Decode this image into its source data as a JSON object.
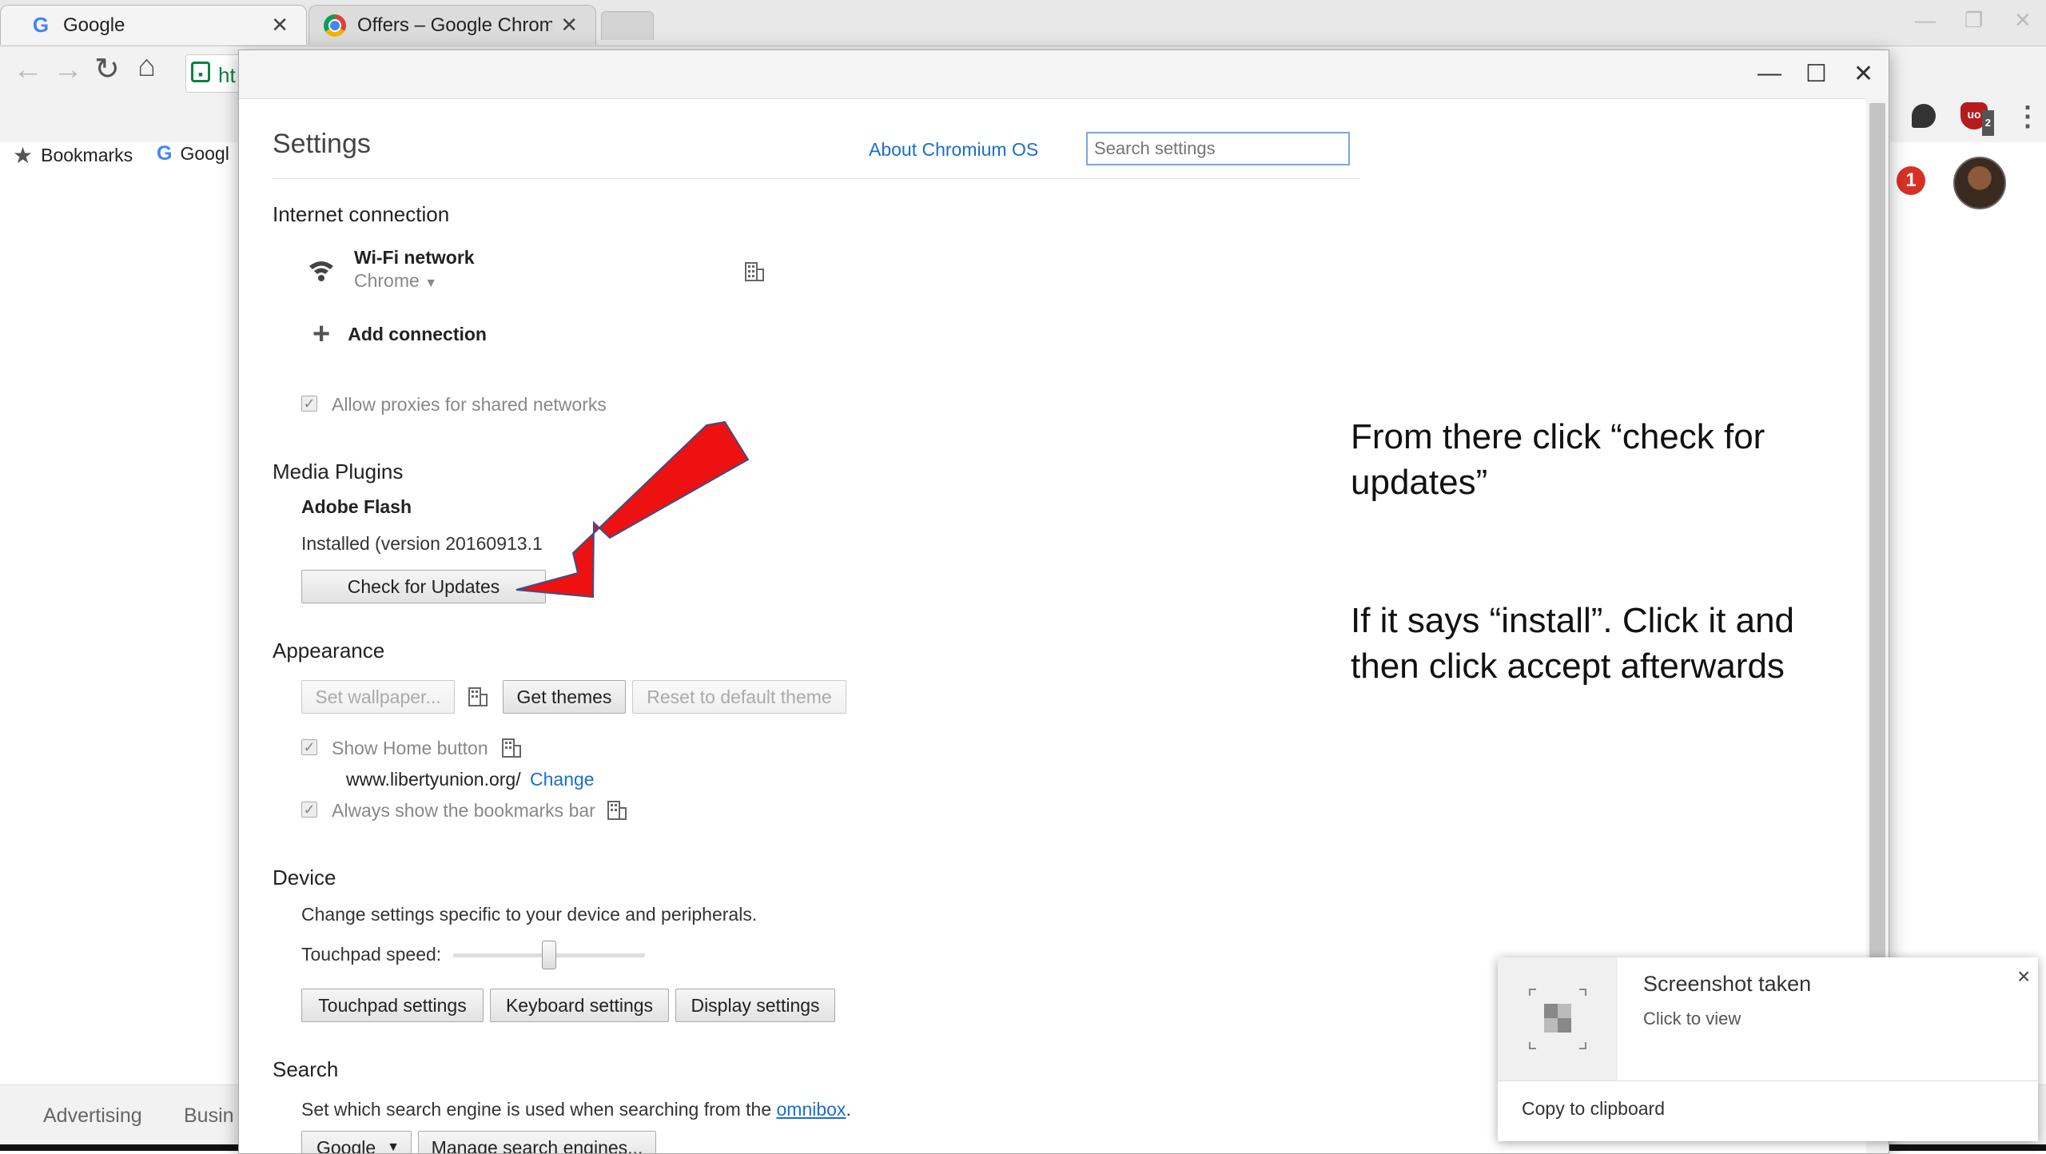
{
  "browser": {
    "tabs": [
      {
        "title": "Google",
        "favicon": "G"
      },
      {
        "title": "Offers – Google Chrome",
        "favicon": "chrome"
      }
    ],
    "url_fragment": "ht",
    "bookmarks": [
      {
        "label": "Bookmarks",
        "icon": "star-icon"
      },
      {
        "label": "Googl",
        "icon": "google-g-icon"
      }
    ],
    "notification_count": "1",
    "extension_badge": "2",
    "footer_links": [
      "Advertising",
      "Busin"
    ]
  },
  "settings": {
    "title": "Settings",
    "about_link": "About Chromium OS",
    "search_placeholder": "Search settings",
    "internet": {
      "heading": "Internet connection",
      "network_name": "Wi-Fi network",
      "network_sub": "Chrome",
      "add_connection": "Add connection",
      "allow_proxies": "Allow proxies for shared networks"
    },
    "media": {
      "heading": "Media Plugins",
      "plugin_name": "Adobe Flash",
      "installed": "Installed (version 20160913.1",
      "check_updates": "Check for Updates"
    },
    "appearance": {
      "heading": "Appearance",
      "set_wallpaper": "Set wallpaper...",
      "get_themes": "Get themes",
      "reset_theme": "Reset to default theme",
      "show_home": "Show Home button",
      "home_url": "www.libertyunion.org/",
      "change": "Change",
      "show_bookmarks": "Always show the bookmarks bar"
    },
    "device": {
      "heading": "Device",
      "description": "Change settings specific to your device and peripherals.",
      "touchpad_speed_label": "Touchpad speed:",
      "touchpad_speed_value": 0.5,
      "touchpad_settings": "Touchpad settings",
      "keyboard_settings": "Keyboard settings",
      "display_settings": "Display settings"
    },
    "search": {
      "heading": "Search",
      "description_prefix": "Set which search engine is used when searching from the ",
      "omnibox_link": "omnibox",
      "description_suffix": ".",
      "engine": "Google",
      "manage": "Manage search engines..."
    }
  },
  "annotation": {
    "line1": "From there click “check for updates”",
    "line2": "If it says “install”. Click it and then click accept afterwards",
    "arrow_color": "#ee1111"
  },
  "toast": {
    "title": "Screenshot taken",
    "subtitle": "Click to view",
    "action": "Copy to clipboard",
    "close": "×"
  }
}
